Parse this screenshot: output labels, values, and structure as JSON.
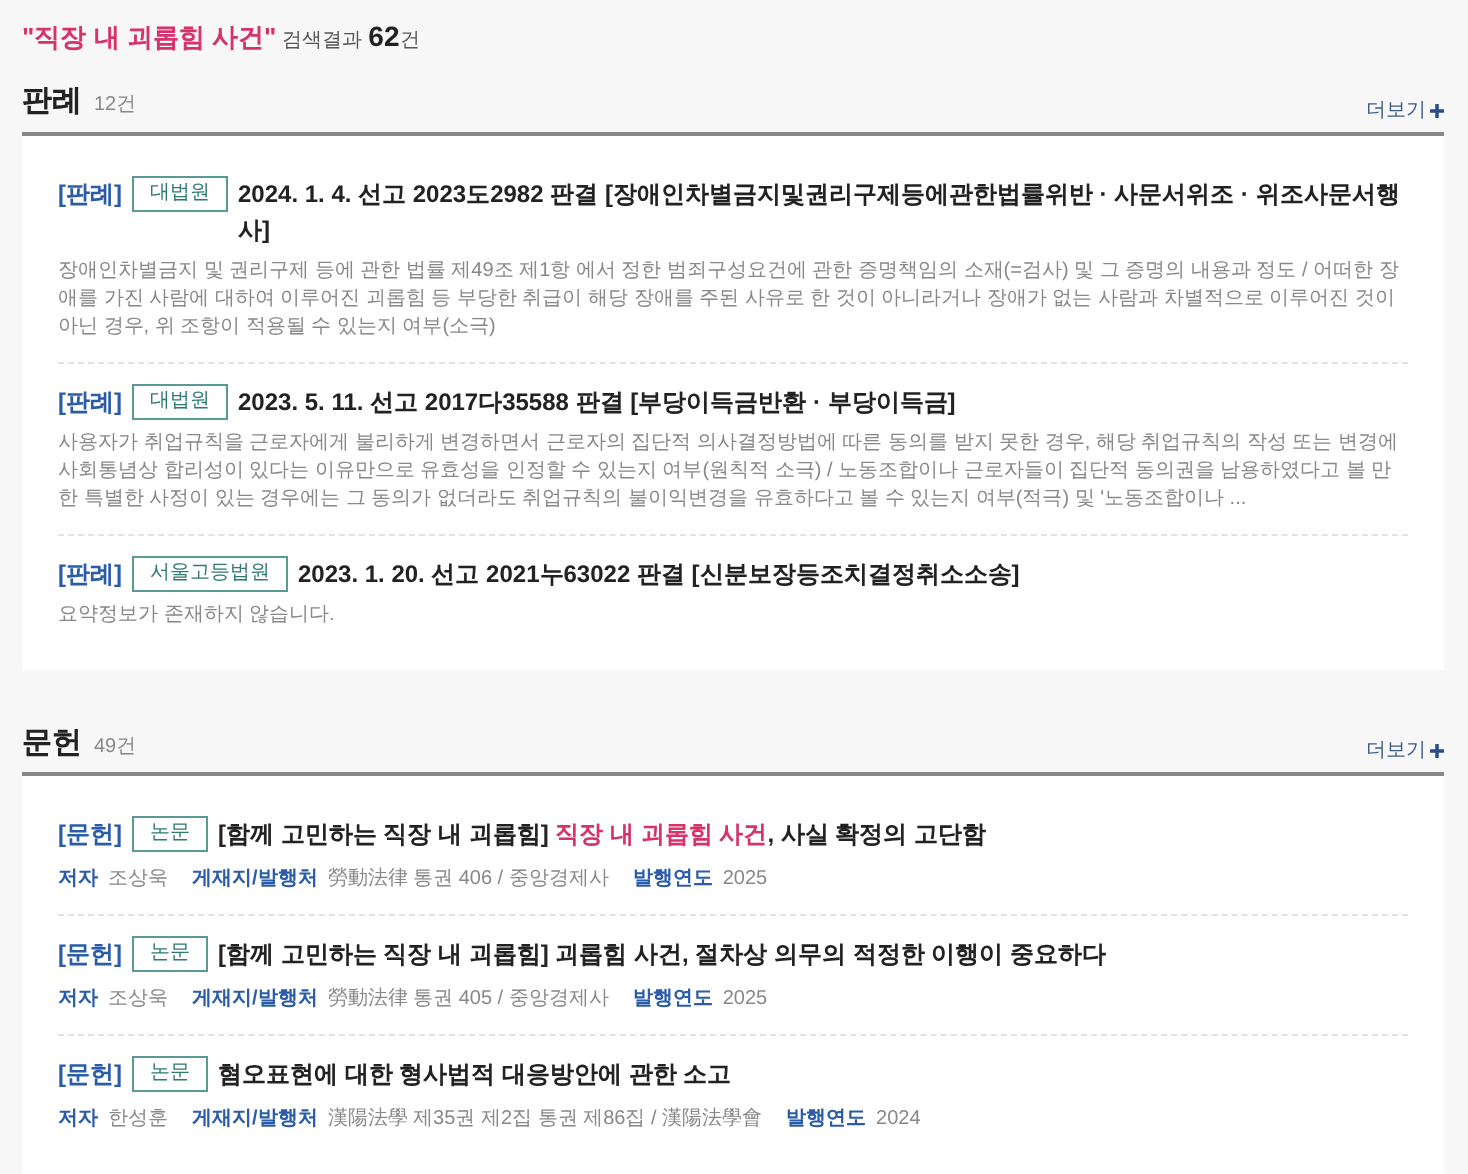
{
  "search_header": {
    "query": "\"직장 내 괴롭힘 사건\"",
    "label": "검색결과",
    "count": "62",
    "unit": "건"
  },
  "sections": [
    {
      "title": "판례",
      "count": "12건",
      "more": "더보기",
      "items": [
        {
          "kind": "case",
          "tag": "[판례]",
          "badge": "대법원",
          "title": [
            {
              "text": "2024. 1. 4. 선고 2023도2982 판결 [장애인차별금지및권리구제등에관한법률위반 · 사문서위조 · 위조사문서행사]",
              "highlighted": false
            }
          ],
          "summary": "장애인차별금지 및 권리구제 등에 관한 법률 제49조 제1항 에서 정한 범죄구성요건에 관한 증명책임의 소재(=검사) 및 그 증명의 내용과 정도 / 어떠한 장애를 가진 사람에 대하여 이루어진 괴롭힘 등 부당한 취급이 해당 장애를 주된 사유로 한 것이 아니라거나 장애가 없는 사람과 차별적으로 이루어진 것이 아닌 경우, 위 조항이 적용될 수 있는지 여부(소극)"
        },
        {
          "kind": "case",
          "tag": "[판례]",
          "badge": "대법원",
          "title": [
            {
              "text": "2023. 5. 11. 선고 2017다35588 판결 [부당이득금반환 · 부당이득금]",
              "highlighted": false
            }
          ],
          "summary": "사용자가 취업규칙을 근로자에게 불리하게 변경하면서 근로자의 집단적 의사결정방법에 따른 동의를 받지 못한 경우, 해당 취업규칙의 작성 또는 변경에 사회통념상 합리성이 있다는 이유만으로 유효성을 인정할 수 있는지 여부(원칙적 소극) / 노동조합이나 근로자들이 집단적 동의권을 남용하였다고 볼 만한 특별한 사정이 있는 경우에는 그 동의가 없더라도 취업규칙의 불이익변경을 유효하다고 볼 수 있는지 여부(적극) 및 '노동조합이나 ..."
        },
        {
          "kind": "case",
          "tag": "[판례]",
          "badge": "서울고등법원",
          "title": [
            {
              "text": "2023. 1. 20. 선고 2021누63022 판결 [신분보장등조치결정취소소송]",
              "highlighted": false
            }
          ],
          "summary": "요약정보가 존재하지 않습니다."
        }
      ]
    },
    {
      "title": "문헌",
      "count": "49건",
      "more": "더보기",
      "items": [
        {
          "kind": "literature",
          "tag": "[문헌]",
          "badge": "논문",
          "title": [
            {
              "text": "[함께 고민하는 직장 내 괴롭힘] ",
              "highlighted": false
            },
            {
              "text": "직장 내 괴롭힘 사건",
              "highlighted": true
            },
            {
              "text": ", 사실 확정의 고단함",
              "highlighted": false
            }
          ],
          "meta": [
            {
              "label": "저자",
              "value": "조상욱"
            },
            {
              "label": "게재지/발행처",
              "value": "勞動法律 통권 406 / 중앙경제사"
            },
            {
              "label": "발행연도",
              "value": "2025"
            }
          ]
        },
        {
          "kind": "literature",
          "tag": "[문헌]",
          "badge": "논문",
          "title": [
            {
              "text": "[함께 고민하는 직장 내 괴롭힘] 괴롭힘 사건, 절차상 의무의 적정한 이행이 중요하다",
              "highlighted": false
            }
          ],
          "meta": [
            {
              "label": "저자",
              "value": "조상욱"
            },
            {
              "label": "게재지/발행처",
              "value": "勞動法律 통권 405 / 중앙경제사"
            },
            {
              "label": "발행연도",
              "value": "2025"
            }
          ]
        },
        {
          "kind": "literature",
          "tag": "[문헌]",
          "badge": "논문",
          "title": [
            {
              "text": "혐오표현에 대한 형사법적 대응방안에 관한 소고",
              "highlighted": false
            }
          ],
          "meta": [
            {
              "label": "저자",
              "value": "한성훈"
            },
            {
              "label": "게재지/발행처",
              "value": "漢陽法學 제35권 제2집 통권 제86집 / 漢陽法學會"
            },
            {
              "label": "발행연도",
              "value": "2024"
            }
          ]
        }
      ]
    }
  ]
}
